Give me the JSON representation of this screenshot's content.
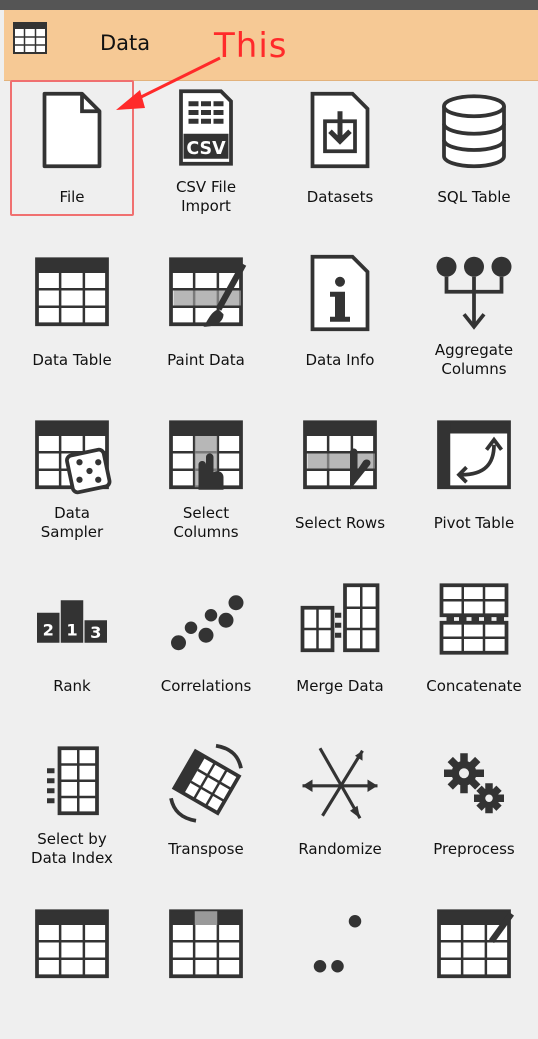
{
  "header": {
    "title": "Data",
    "annotation": "This"
  },
  "accent_color": "#f6c995",
  "annotation_color": "#ff2a2a",
  "widgets": [
    {
      "label": "File",
      "icon": "file-icon",
      "selected": true
    },
    {
      "label": "CSV File\nImport",
      "icon": "csv-icon"
    },
    {
      "label": "Datasets",
      "icon": "datasets-icon"
    },
    {
      "label": "SQL Table",
      "icon": "database-icon"
    },
    {
      "label": "Data Table",
      "icon": "table-icon"
    },
    {
      "label": "Paint Data",
      "icon": "paint-icon"
    },
    {
      "label": "Data Info",
      "icon": "info-icon"
    },
    {
      "label": "Aggregate\nColumns",
      "icon": "aggregate-icon"
    },
    {
      "label": "Data\nSampler",
      "icon": "sampler-icon"
    },
    {
      "label": "Select\nColumns",
      "icon": "select-columns-icon"
    },
    {
      "label": "Select Rows",
      "icon": "select-rows-icon"
    },
    {
      "label": "Pivot Table",
      "icon": "pivot-icon"
    },
    {
      "label": "Rank",
      "icon": "rank-icon"
    },
    {
      "label": "Correlations",
      "icon": "correlations-icon"
    },
    {
      "label": "Merge Data",
      "icon": "merge-icon"
    },
    {
      "label": "Concatenate",
      "icon": "concatenate-icon"
    },
    {
      "label": "Select by\nData Index",
      "icon": "select-by-index-icon"
    },
    {
      "label": "Transpose",
      "icon": "transpose-icon"
    },
    {
      "label": "Randomize",
      "icon": "randomize-icon"
    },
    {
      "label": "Preprocess",
      "icon": "preprocess-icon"
    },
    {
      "label": "",
      "icon": "apply-domain-icon"
    },
    {
      "label": "",
      "icon": "impute-icon"
    },
    {
      "label": "",
      "icon": "outliers-icon"
    },
    {
      "label": "",
      "icon": "edit-domain-icon"
    }
  ]
}
